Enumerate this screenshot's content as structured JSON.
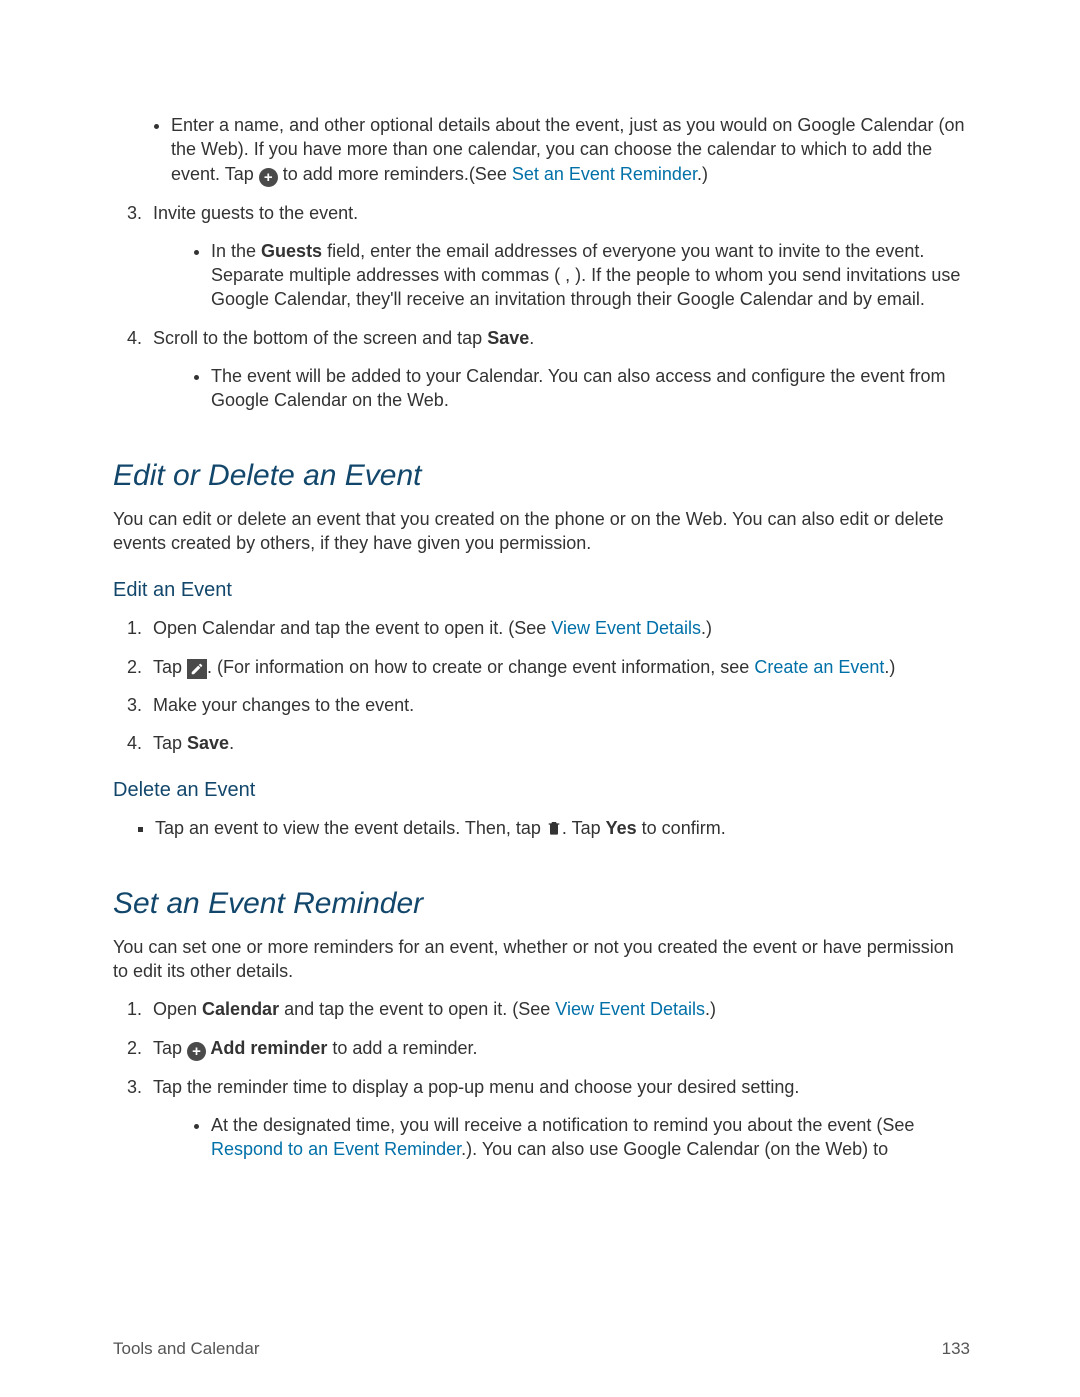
{
  "top_list": {
    "bullet1_a": "Enter a name, and other optional details about the event, just as you would on Google Calendar (on the Web). If you have more than one calendar, you can choose the calendar to which to add the event. Tap ",
    "bullet1_b": " to add more reminders.(See ",
    "bullet1_link": "Set an Event Reminder",
    "bullet1_c": ".)",
    "step3": "Invite guests to the event.",
    "step3_sub_a": "In the ",
    "step3_sub_b": "Guests",
    "step3_sub_c": " field, enter the email addresses of everyone you want to invite to the event. Separate multiple addresses with commas ( , ). If the people to whom you send invitations use Google Calendar, they'll receive an invitation through their Google Calendar and by email.",
    "step4_a": "Scroll to the bottom of the screen and tap ",
    "step4_b": "Save",
    "step4_c": ".",
    "step4_sub": "The event will be added to your Calendar. You can also access and configure the event from Google Calendar on the Web."
  },
  "edit_section": {
    "heading": "Edit or Delete an Event",
    "intro": "You can edit or delete an event that you created on the phone or on the Web. You can also edit or delete events created by others, if they have given you permission.",
    "sub_edit": "Edit an Event",
    "e1_a": "Open Calendar and tap the event to open it. (See ",
    "e1_link": "View Event Details",
    "e1_b": ".)",
    "e2_a": "Tap ",
    "e2_b": ". (For information on how to create or change event information, see ",
    "e2_link": "Create an Event",
    "e2_c": ".)",
    "e3": "Make your changes to the event.",
    "e4_a": "Tap ",
    "e4_b": "Save",
    "e4_c": ".",
    "sub_delete": "Delete an Event",
    "d1_a": "Tap an event to view the event details. Then, tap ",
    "d1_b": ". Tap ",
    "d1_c": "Yes",
    "d1_d": " to confirm."
  },
  "reminder_section": {
    "heading": "Set an Event Reminder",
    "intro": "You can set one or more reminders for an event, whether or not you created the event or have permission to edit its other details.",
    "r1_a": "Open ",
    "r1_b": "Calendar",
    "r1_c": " and tap the event to open it. (See ",
    "r1_link": "View Event Details",
    "r1_d": ".)",
    "r2_a": "Tap ",
    "r2_b": " Add reminder",
    "r2_c": " to add a reminder.",
    "r3": "Tap the reminder time to display a pop-up menu and choose your desired setting.",
    "r3_sub_a": "At the designated time, you will receive a notification to remind you about the event (See ",
    "r3_sub_link": "Respond to an Event Reminder",
    "r3_sub_b": ".). You can also use Google Calendar (on the Web) to"
  },
  "footer": {
    "left": "Tools and Calendar",
    "right": "133"
  }
}
